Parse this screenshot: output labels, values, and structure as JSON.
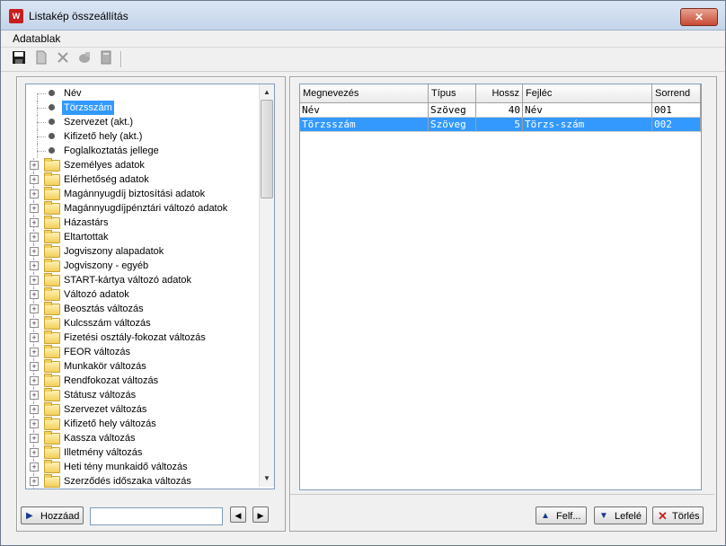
{
  "window": {
    "title": "Listakép összeállítás",
    "close_label": "✕"
  },
  "menu": {
    "items": [
      "Adatablak"
    ]
  },
  "toolbar": {
    "icons": [
      "save-icon",
      "document-icon",
      "delete-icon",
      "eraser-icon",
      "calculator-icon"
    ]
  },
  "tree": {
    "leaves": [
      "Név",
      "Törzsszám",
      "Szervezet (akt.)",
      "Kifizető hely (akt.)",
      "Foglalkoztatás jellege"
    ],
    "selected_leaf": "Törzsszám",
    "folders": [
      "Személyes adatok",
      "Elérhetőség adatok",
      "Magánnyugdíj biztosítási adatok",
      "Magánnyugdíjpénztári változó adatok",
      "Házastárs",
      "Eltartottak",
      "Jogviszony alapadatok",
      "Jogviszony - egyéb",
      "START-kártya változó adatok",
      "Változó adatok",
      "Beosztás változás",
      "Kulcsszám változás",
      "Fizetési osztály-fokozat változás",
      "FEOR változás",
      "Munkakör változás",
      "Rendfokozat változás",
      "Státusz változás",
      "Szervezet változás",
      "Kifizető hely változás",
      "Kassza változás",
      "Illetmény változás",
      "Heti tény munkaidő változás",
      "Szerződés időszaka változás"
    ]
  },
  "grid": {
    "columns": [
      "Megnevezés",
      "Típus",
      "Hossz",
      "Fejléc",
      "Sorrend"
    ],
    "rows": [
      [
        "Név",
        "Szöveg",
        "40",
        "Név",
        "001"
      ],
      [
        "Törzsszám",
        "Szöveg",
        "5",
        "Törzs-szám",
        "002"
      ]
    ],
    "selected_row": 1
  },
  "left_footer": {
    "add_label": "Hozzáad",
    "add_field_value": "",
    "prev_label": "◀",
    "next_label": "▶"
  },
  "right_footer": {
    "up_label": "Felf...",
    "down_label": "Lefelé",
    "delete_label": "Törlés"
  },
  "colors": {
    "selection": "#3399ff",
    "close_button": "#c74a33"
  }
}
